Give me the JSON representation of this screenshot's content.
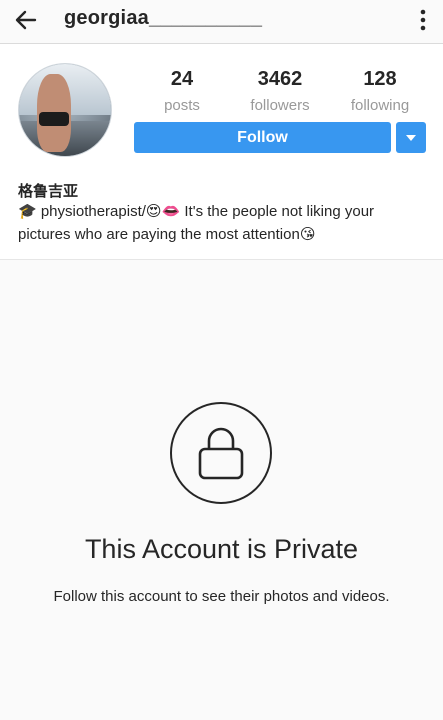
{
  "topbar": {
    "title": "georgiaa__________",
    "back_icon": "arrow-left-icon",
    "more_icon": "vertical-dots-icon"
  },
  "profile": {
    "stats": [
      {
        "value": "24",
        "label": "posts"
      },
      {
        "value": "3462",
        "label": "followers"
      },
      {
        "value": "128",
        "label": "following"
      }
    ],
    "follow_label": "Follow",
    "dropdown_icon": "caret-down-icon",
    "name": "格鲁吉亚",
    "bio": "🎓 physiotherapist/😍👄 It's the people not liking your pictures who are paying the most attention😘"
  },
  "private_notice": {
    "icon": "lock-icon",
    "title": "This Account is Private",
    "subtitle": "Follow this account to see their photos and videos."
  },
  "colors": {
    "accent": "#3897f0",
    "text": "#262626",
    "muted": "#999999",
    "background": "#fafafa"
  }
}
